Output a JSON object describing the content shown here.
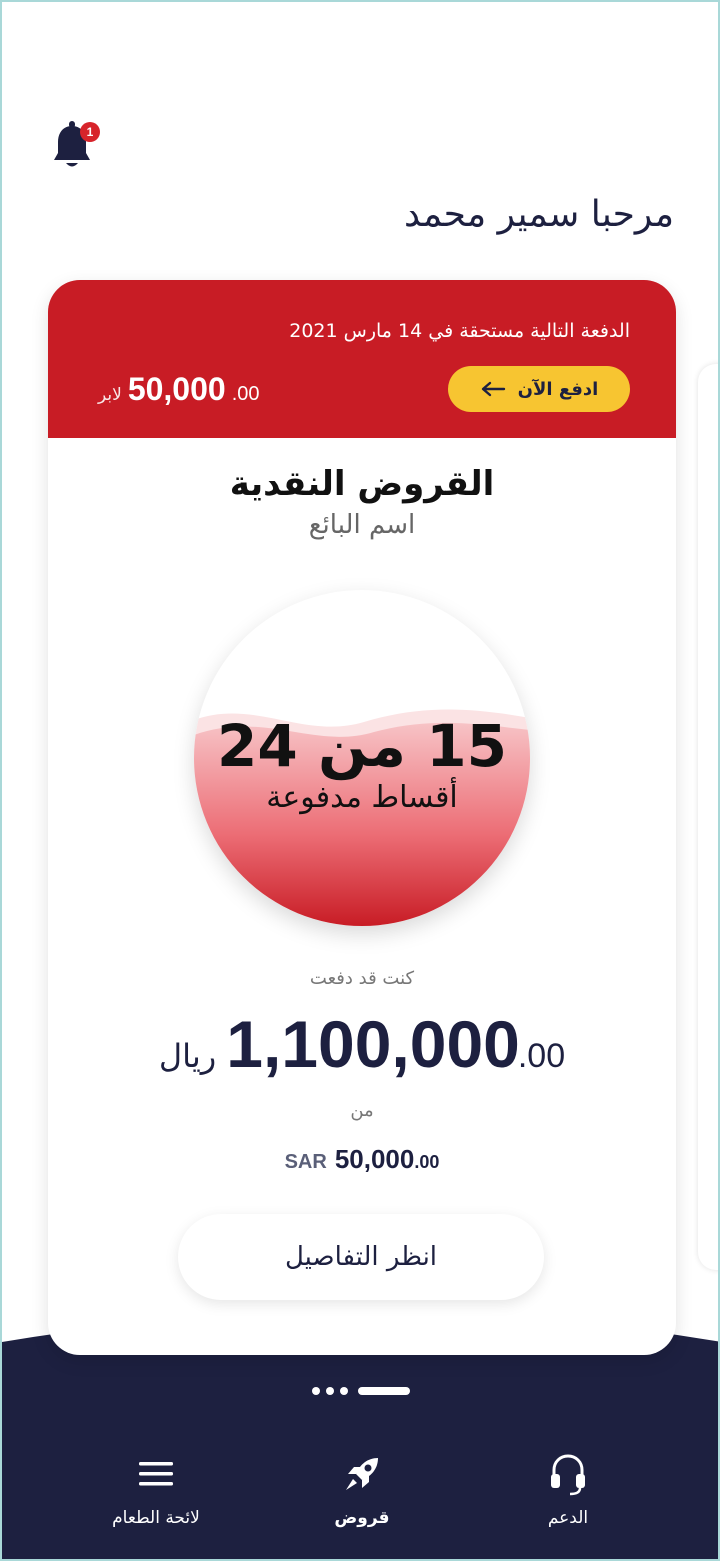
{
  "header": {
    "notification_count": "1",
    "greeting": "مرحبا سمير محمد"
  },
  "loan_card": {
    "due_text": "الدفعة التالية مستحقة في 14 مارس 2021",
    "pay_now_label": "ادفع الآن",
    "next_payment": {
      "currency": "لابر",
      "amount": "50,000",
      "decimals": ".00"
    },
    "title": "القروض النقدية",
    "vendor": "اسم البائع",
    "installments": {
      "count_text": "15 من 24",
      "label": "أقساط مدفوعة",
      "paid": 15,
      "total": 24
    },
    "paid_label": "كنت قد دفعت",
    "paid_amount": {
      "currency": "ريال",
      "amount": "1,100,000",
      "decimals": ".00"
    },
    "of_label": "من",
    "total_amount": {
      "currency": "SAR",
      "amount": "50,000",
      "decimals": ".00"
    },
    "details_button": "انظر التفاصيل"
  },
  "bottom_nav": {
    "items": [
      {
        "label": "الدعم",
        "icon": "headset-icon"
      },
      {
        "label": "قروض",
        "icon": "rocket-icon",
        "active": true
      },
      {
        "label": "لائحة الطعام",
        "icon": "menu-icon"
      }
    ]
  },
  "colors": {
    "brand_red": "#c81c25",
    "accent_yellow": "#f7c531",
    "navy": "#1d2040",
    "badge_red": "#d7242b"
  }
}
